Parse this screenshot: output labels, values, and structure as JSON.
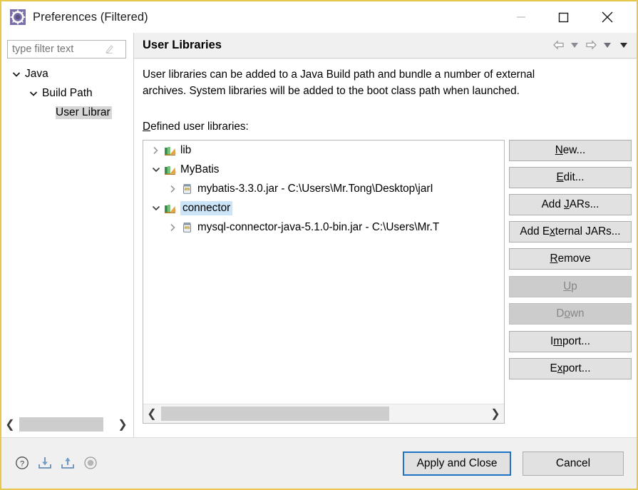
{
  "window": {
    "title": "Preferences (Filtered)",
    "icon": "preferences-gear-icon",
    "accent_border": "#e8c84a",
    "controls": {
      "minimize": "minimize-icon",
      "maximize": "maximize-icon",
      "close": "close-icon"
    }
  },
  "sidebar": {
    "filter": {
      "value": "",
      "placeholder": "type filter text",
      "clear_icon": "clear-filter-icon"
    },
    "tree": [
      {
        "label": "Java",
        "expanded": true,
        "depth": 0,
        "selected": false
      },
      {
        "label": "Build Path",
        "expanded": true,
        "depth": 1,
        "selected": false
      },
      {
        "label": "User Librar",
        "expanded": null,
        "depth": 2,
        "selected": true
      }
    ],
    "scrollbar": {
      "left_arrow": "chevron-left-icon",
      "right_arrow": "chevron-right-icon"
    }
  },
  "page": {
    "title": "User Libraries",
    "toolbar": [
      {
        "name": "back-icon"
      },
      {
        "name": "back-dropdown-icon"
      },
      {
        "name": "forward-icon"
      },
      {
        "name": "forward-dropdown-icon"
      },
      {
        "name": "menu-dropdown-icon"
      }
    ],
    "description": "User libraries can be added to a Java Build path and bundle a number of external archives. System libraries will be added to the boot class path when launched.",
    "list_label": "Defined user libraries:",
    "list_label_mnemonic": "D",
    "libraries": [
      {
        "label": "lib",
        "expanded": false,
        "depth": 0,
        "selected": false,
        "icon": "user-library-icon"
      },
      {
        "label": "MyBatis",
        "expanded": true,
        "depth": 0,
        "selected": false,
        "icon": "user-library-icon"
      },
      {
        "label": "mybatis-3.3.0.jar - C:\\Users\\Mr.Tong\\Desktop\\jarI",
        "expanded": false,
        "depth": 1,
        "selected": false,
        "icon": "jar-icon"
      },
      {
        "label": "connector",
        "expanded": true,
        "depth": 0,
        "selected": true,
        "icon": "user-library-icon"
      },
      {
        "label": "mysql-connector-java-5.1.0-bin.jar - C:\\Users\\Mr.T",
        "expanded": false,
        "depth": 1,
        "selected": false,
        "icon": "jar-icon"
      }
    ],
    "list_scrollbar": {
      "left_arrow": "chevron-left-icon",
      "right_arrow": "chevron-right-icon"
    },
    "buttons": [
      {
        "label": "New...",
        "mnemonic": "N",
        "enabled": true,
        "gap_above": false
      },
      {
        "label": "Edit...",
        "mnemonic": "E",
        "enabled": true,
        "gap_above": false
      },
      {
        "label": "Add JARs...",
        "mnemonic": "J",
        "enabled": true,
        "gap_above": false
      },
      {
        "label": "Add External JARs...",
        "mnemonic": "x",
        "enabled": true,
        "gap_above": false
      },
      {
        "label": "Remove",
        "mnemonic": "R",
        "enabled": true,
        "gap_above": false
      },
      {
        "label": "Up",
        "mnemonic": "U",
        "enabled": false,
        "gap_above": true
      },
      {
        "label": "Down",
        "mnemonic": "o",
        "enabled": false,
        "gap_above": false
      },
      {
        "label": "Import...",
        "mnemonic": "m",
        "enabled": true,
        "gap_above": true
      },
      {
        "label": "Export...",
        "mnemonic": "x",
        "enabled": true,
        "gap_above": false
      }
    ]
  },
  "footer": {
    "icons": [
      {
        "name": "help-icon"
      },
      {
        "name": "import-preferences-icon"
      },
      {
        "name": "export-preferences-icon"
      },
      {
        "name": "restore-defaults-icon"
      }
    ],
    "apply_close_label": "Apply and Close",
    "cancel_label": "Cancel",
    "focus_color": "#1e73c4"
  }
}
